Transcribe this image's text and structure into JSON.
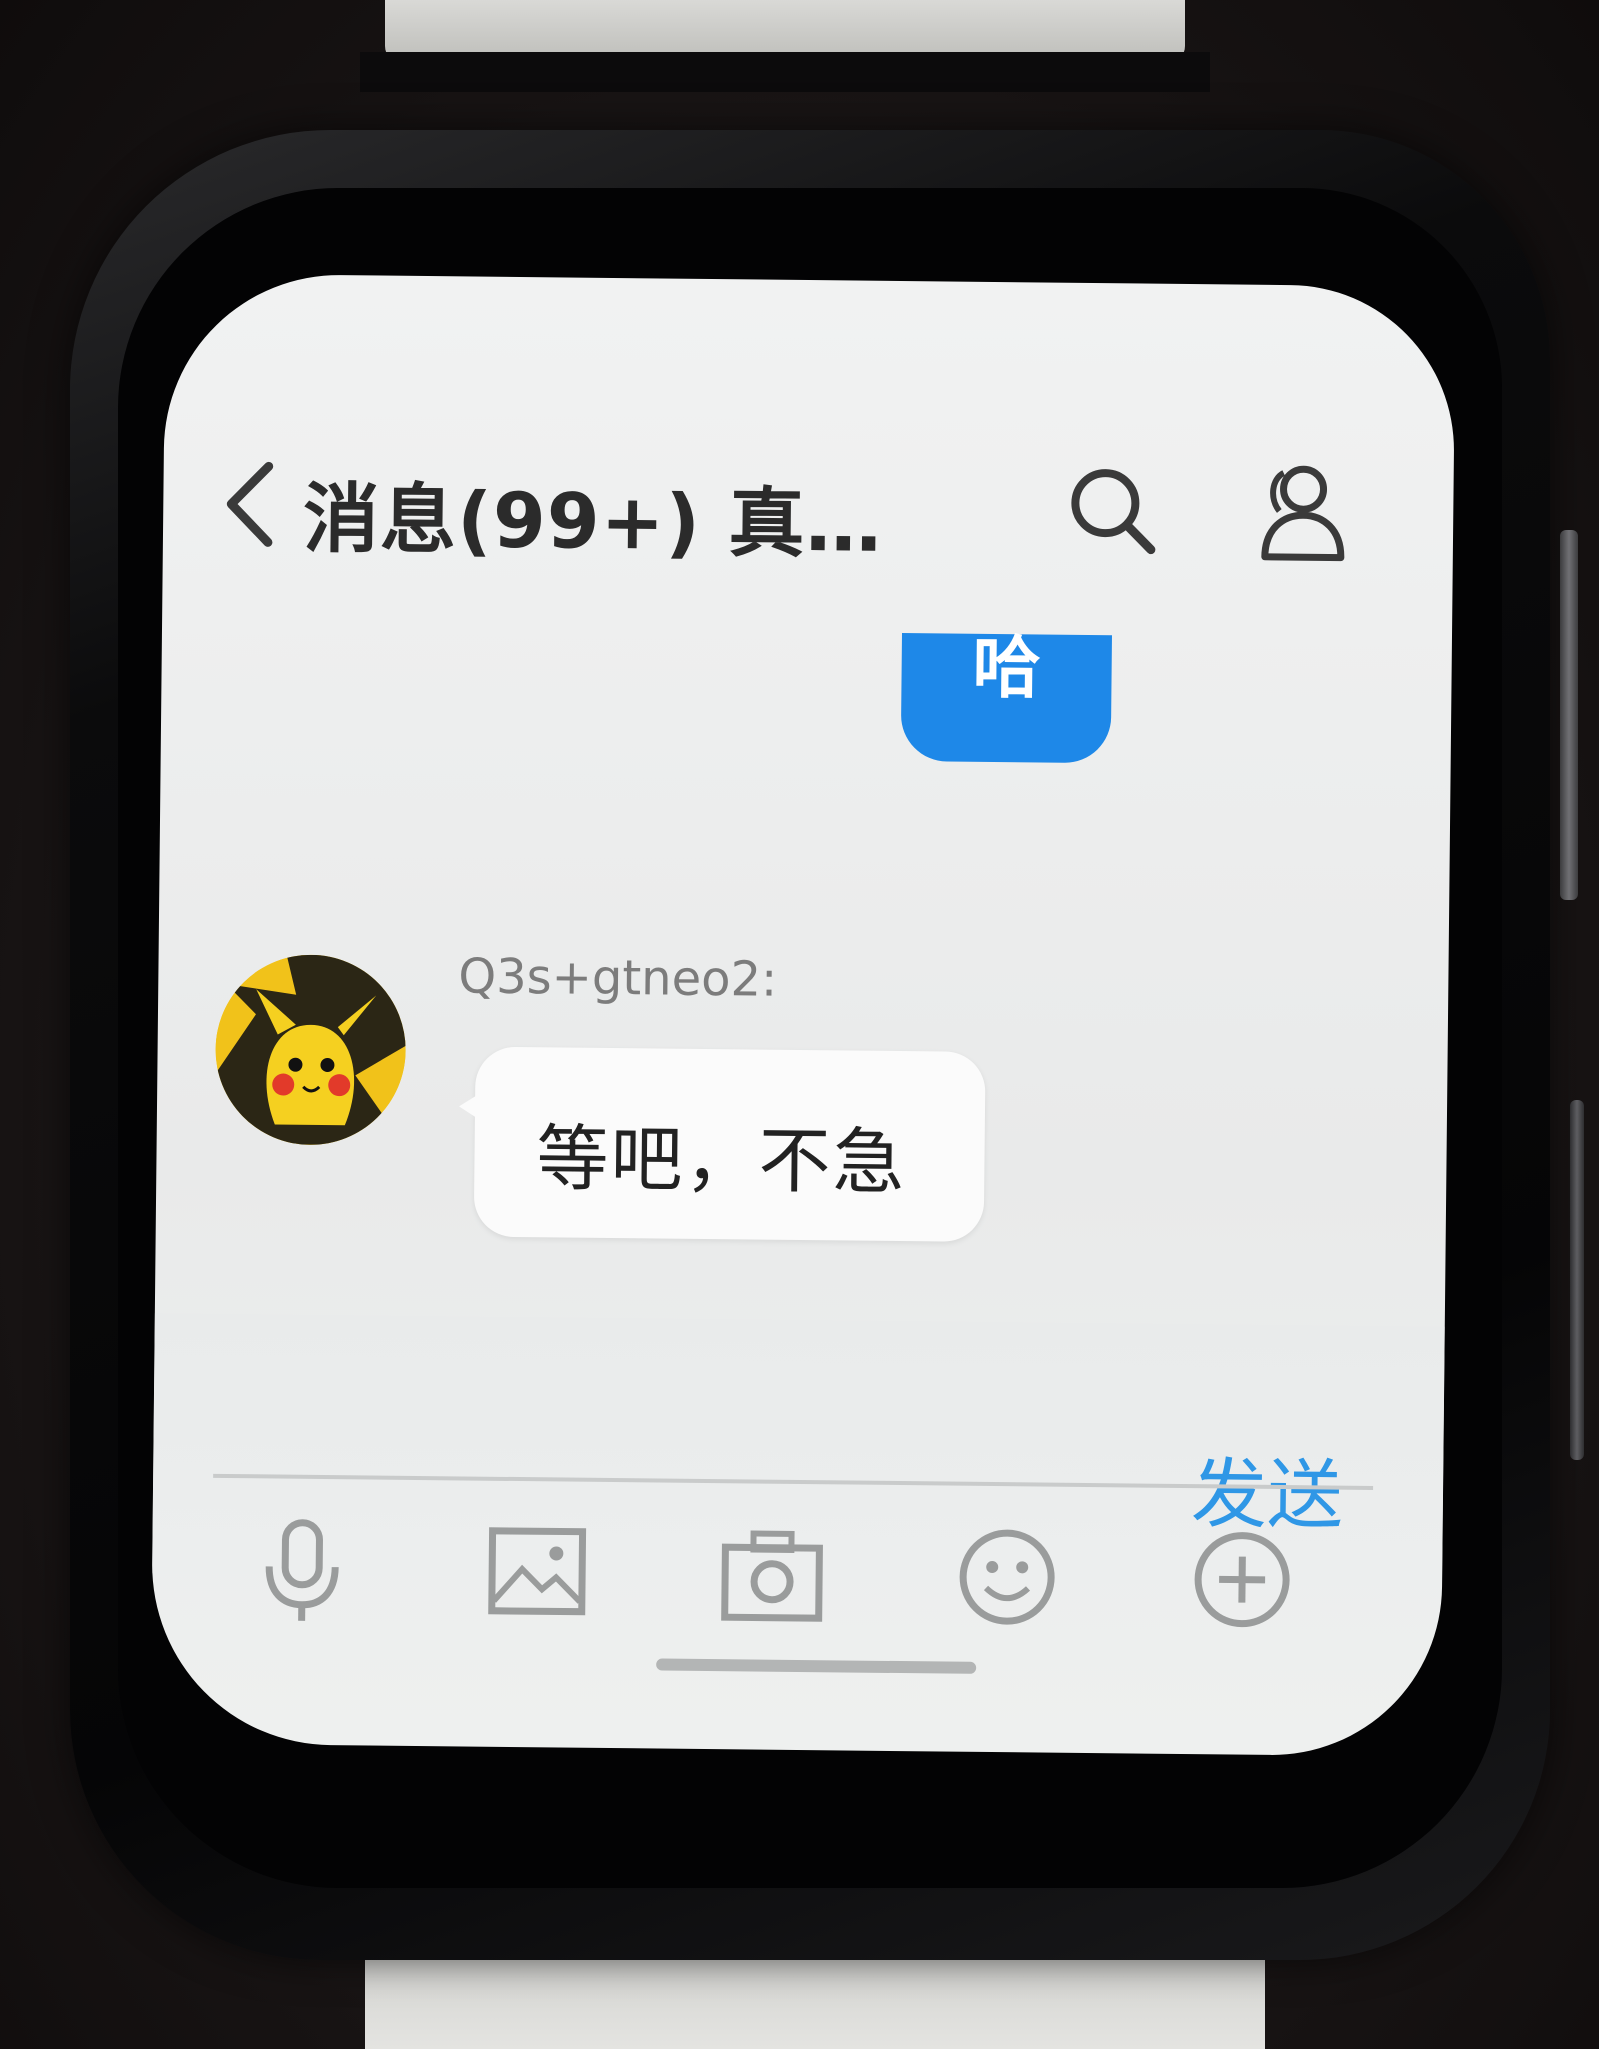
{
  "header": {
    "back_label": "‹",
    "title": "消息(99+)  真…"
  },
  "messages": {
    "sent": {
      "text": "哈"
    },
    "received": {
      "sender": "Q3s+gtneo2:",
      "text": "等吧，不急"
    }
  },
  "compose": {
    "send_label": "发送"
  },
  "toolbar": {
    "icons": [
      "microphone-icon",
      "image-icon",
      "camera-icon",
      "emoji-icon",
      "add-icon"
    ]
  },
  "colors": {
    "accent": "#1e88e8",
    "send_text": "#2f97e6",
    "avatar_yellow": "#f1c21a"
  }
}
